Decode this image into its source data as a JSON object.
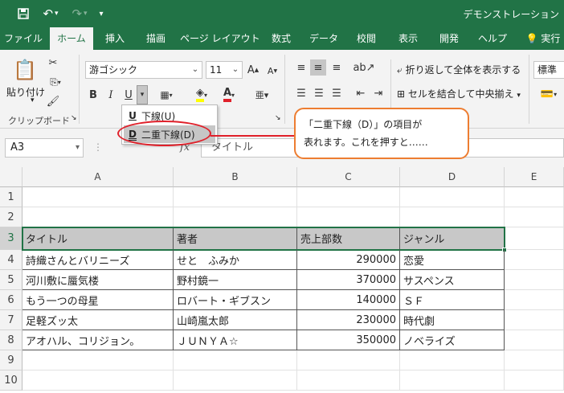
{
  "app": {
    "doc_title": "デモンストレーション",
    "accent": "#217346"
  },
  "tabs": [
    "ファイル",
    "ホーム",
    "挿入",
    "描画",
    "ページ レイアウト",
    "数式",
    "データ",
    "校閲",
    "表示",
    "開発",
    "ヘルプ",
    "実行"
  ],
  "active_tab": "ホーム",
  "ribbon": {
    "paste_label": "貼り付け",
    "clipboard_group": "クリップボード",
    "font_name": "游ゴシック",
    "font_size": "11",
    "bold": "B",
    "italic": "I",
    "underline": "U",
    "font_color_letter": "A",
    "wrap_text": "折り返して全体を表示する",
    "merge_center": "セルを結合して中央揃え",
    "number_format": "標準"
  },
  "underline_menu": {
    "items": [
      {
        "icon": "U",
        "label": "下線(U)"
      },
      {
        "icon": "D",
        "label": "二重下線(D)"
      }
    ],
    "highlighted": 1
  },
  "callout": {
    "line1": "「二重下線（D）」の項目が",
    "line2": "表れます。これを押すと……"
  },
  "formula_bar": {
    "name_box": "A3",
    "fx_label": "fx",
    "formula": "タイトル"
  },
  "sheet": {
    "columns": [
      "A",
      "B",
      "C",
      "D",
      "E"
    ],
    "rows": [
      "1",
      "2",
      "3",
      "4",
      "5",
      "6",
      "7",
      "8",
      "9",
      "10"
    ],
    "header": [
      "タイトル",
      "著者",
      "売上部数",
      "ジャンル"
    ],
    "data": [
      [
        "詩織さんとバリニーズ",
        "せと　ふみか",
        "290000",
        "恋愛"
      ],
      [
        "河川敷に蜃気楼",
        "野村鏡一",
        "370000",
        "サスペンス"
      ],
      [
        "もう一つの母星",
        "ロバート・ギブスン",
        "140000",
        "ＳＦ"
      ],
      [
        "足軽ズッ太",
        "山崎嵐太郎",
        "230000",
        "時代劇"
      ],
      [
        "アオハル、コリジョン。",
        "ＪＵＮＹＡ☆",
        "350000",
        "ノベライズ"
      ]
    ]
  }
}
